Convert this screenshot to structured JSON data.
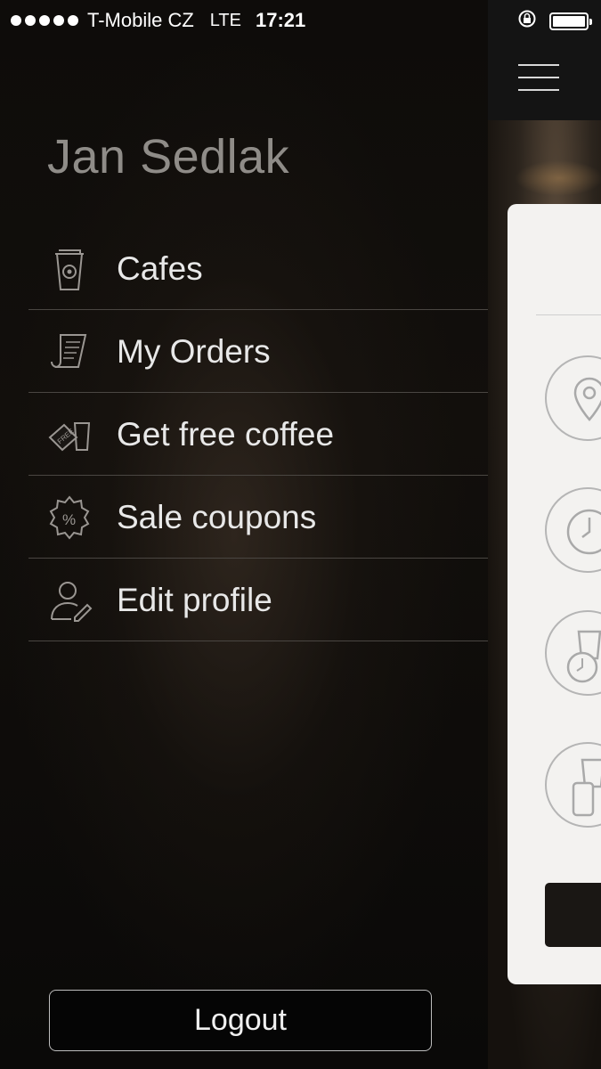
{
  "status_bar": {
    "carrier": "T-Mobile CZ",
    "network": "LTE",
    "time": "17:21"
  },
  "drawer": {
    "user_name": "Jan Sedlak",
    "menu": [
      {
        "label": "Cafes",
        "icon": "coffee-cup-icon"
      },
      {
        "label": "My Orders",
        "icon": "receipt-icon"
      },
      {
        "label": "Get free coffee",
        "icon": "free-tag-icon"
      },
      {
        "label": "Sale coupons",
        "icon": "percent-badge-icon"
      },
      {
        "label": "Edit profile",
        "icon": "user-edit-icon"
      }
    ],
    "logout_label": "Logout"
  },
  "main": {
    "features": [
      "location-pin-icon",
      "clock-icon",
      "cup-clock-icon",
      "phone-cup-icon"
    ]
  }
}
